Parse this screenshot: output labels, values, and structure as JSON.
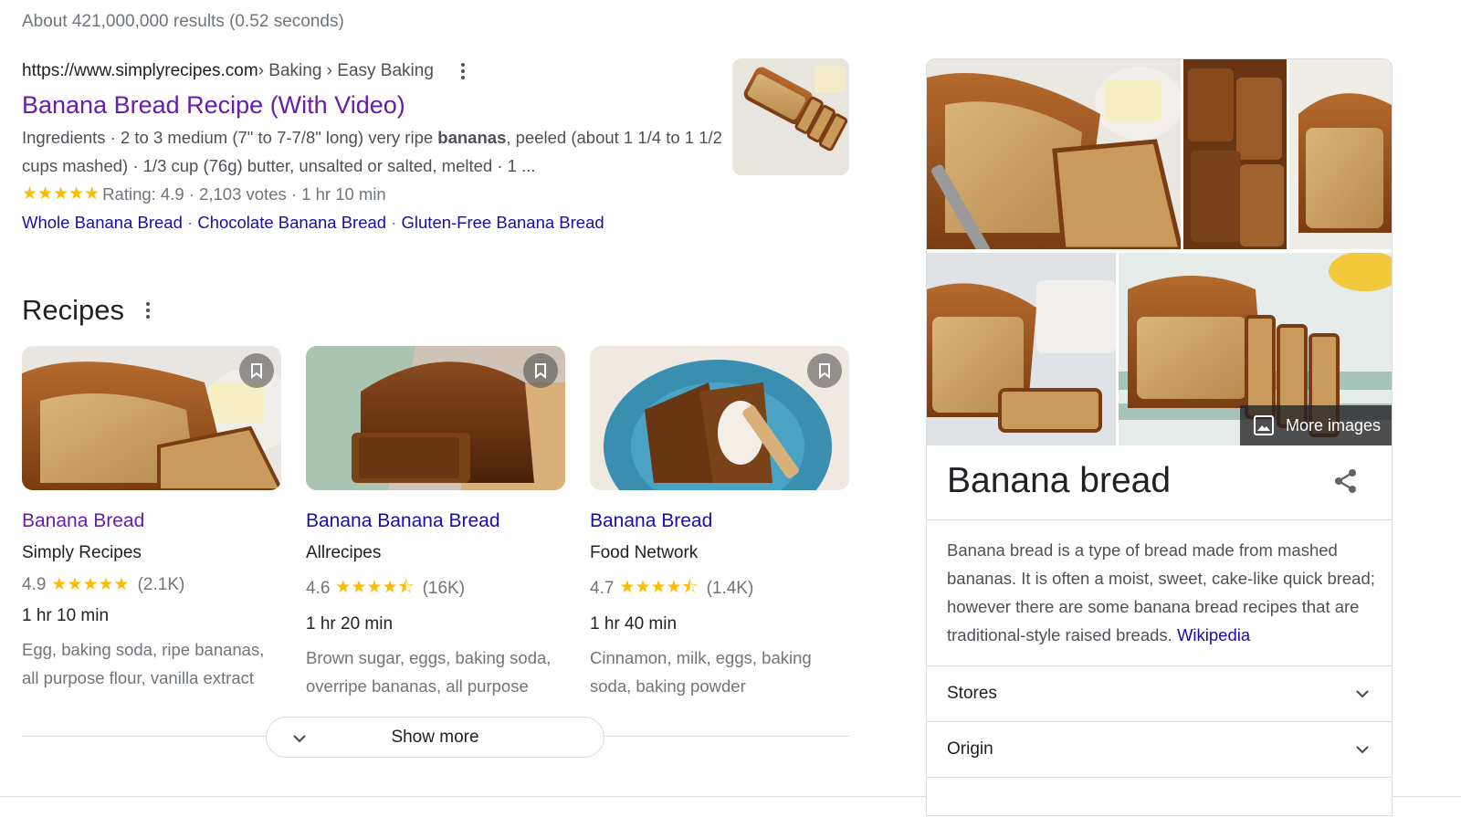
{
  "stats": "About 421,000,000 results (0.52 seconds)",
  "result": {
    "domain": "https://www.simplyrecipes.com",
    "path": " › Baking › Easy Baking",
    "title": "Banana Bread Recipe (With Video)",
    "snippet_1": "Ingredients · 2 to 3 medium (7\" to 7-7/8\" long) very ripe ",
    "snippet_bold": "bananas",
    "snippet_2": ", peeled (about 1 1/4 to 1 1/2 cups mashed) · 1/3 cup (76g) butter, unsalted or salted, melted · 1 ...",
    "stars": "★★★★★",
    "rating_text": "Rating: 4.9 · 2,103 votes · 1 hr 10 min",
    "sitelinks": [
      "Whole Banana Bread",
      "Chocolate Banana Bread",
      "Gluten-Free Banana Bread"
    ],
    "sitelink_sep": " · ",
    "thumbnail_icon": "banana-bread-photo"
  },
  "recipes": {
    "heading": "Recipes",
    "cards": [
      {
        "title": "Banana Bread",
        "source": "Simply Recipes",
        "rating": "4.9",
        "stars": "★★★★★",
        "count": "(2.1K)",
        "time": "1 hr 10 min",
        "ingredients": "Egg, baking soda, ripe bananas, all purpose flour, vanilla extract"
      },
      {
        "title": "Banana Banana Bread",
        "source": "Allrecipes",
        "rating": "4.6",
        "stars": "★★★★⯪",
        "count": "(16K)",
        "time": "1 hr 20 min",
        "ingredients": "Brown sugar, eggs, baking soda, overripe bananas, all purpose"
      },
      {
        "title": "Banana Bread",
        "source": "Food Network",
        "rating": "4.7",
        "stars": "★★★★⯪",
        "count": "(1.4K)",
        "time": "1 hr 40 min",
        "ingredients": "Cinnamon, milk, eggs, baking soda, baking powder"
      }
    ],
    "show_more": "Show more"
  },
  "knowledge_panel": {
    "more_images": "More images",
    "title": "Banana bread",
    "description": "Banana bread is a type of bread made from mashed bananas. It is often a moist, sweet, cake-like quick bread; however there are some banana bread recipes that are traditional-style raised breads. ",
    "wiki_link": "Wikipedia",
    "rows": [
      "Stores",
      "Origin"
    ]
  },
  "colors": {
    "link": "#1a0dab",
    "visited": "#681da8",
    "star": "#fbbc04",
    "text_secondary": "#70757a"
  }
}
